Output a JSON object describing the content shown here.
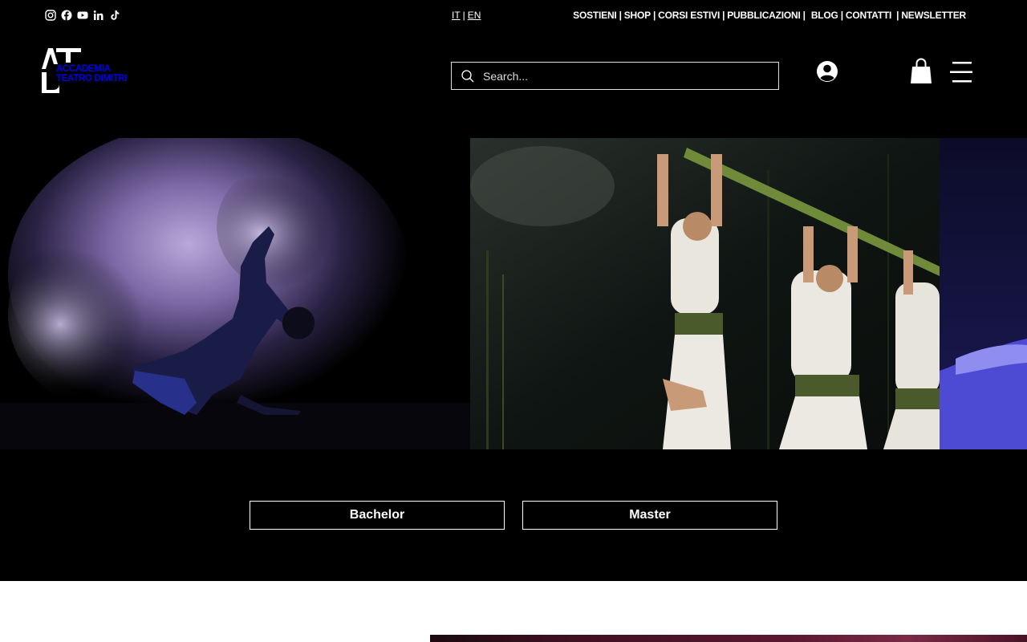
{
  "lang": {
    "it": "IT",
    "sep": "|",
    "en": "EN"
  },
  "topnav": [
    "SOSTIENI",
    "SHOP",
    "CORSI ESTIVI",
    "PUBBLICAZIONI",
    "BLOG",
    "CONTATTI",
    "NEWSLETTER"
  ],
  "topnav_sep": "|",
  "logo": {
    "line1": "ACCADEMIA",
    "line2": "TEATRO DIMITRI"
  },
  "search": {
    "placeholder": "Search..."
  },
  "programs": {
    "bachelor": "Bachelor",
    "master": "Master"
  },
  "social_icons": [
    "instagram-icon",
    "facebook-icon",
    "youtube-icon",
    "linkedin-icon",
    "tiktok-icon"
  ],
  "colors": {
    "background": "#000000",
    "text": "#ffffff",
    "accent_band": "#ffffff"
  }
}
